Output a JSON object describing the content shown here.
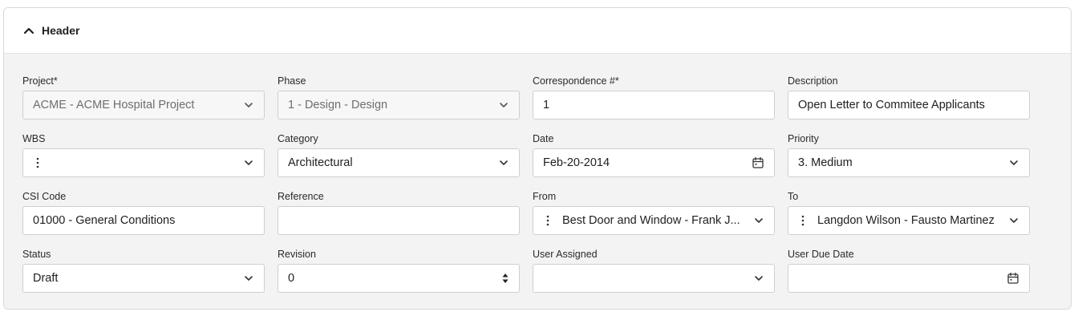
{
  "panel": {
    "title": "Header"
  },
  "fields": {
    "project": {
      "label": "Project*",
      "value": "ACME - ACME Hospital Project"
    },
    "phase": {
      "label": "Phase",
      "value": "1 - Design - Design"
    },
    "correspondence": {
      "label": "Correspondence #*",
      "value": "1"
    },
    "description": {
      "label": "Description",
      "value": "Open Letter to Commitee Applicants"
    },
    "wbs": {
      "label": "WBS",
      "value": ""
    },
    "category": {
      "label": "Category",
      "value": "Architectural"
    },
    "date": {
      "label": "Date",
      "value": "Feb-20-2014"
    },
    "priority": {
      "label": "Priority",
      "value": "3. Medium"
    },
    "csi_code": {
      "label": "CSI Code",
      "value": "01000 - General Conditions"
    },
    "reference": {
      "label": "Reference",
      "value": ""
    },
    "from": {
      "label": "From",
      "value": "Best Door and Window - Frank J..."
    },
    "to": {
      "label": "To",
      "value": "Langdon Wilson - Fausto Martinez"
    },
    "status": {
      "label": "Status",
      "value": "Draft"
    },
    "revision": {
      "label": "Revision",
      "value": "0"
    },
    "user_assigned": {
      "label": "User Assigned",
      "value": ""
    },
    "user_due_date": {
      "label": "User Due Date",
      "value": ""
    }
  },
  "icons": {
    "collapse": "chevron-up-icon",
    "dropdown": "chevron-down-icon",
    "calendar": "calendar-icon",
    "more": "kebab-icon",
    "spinner": "spinner-arrows-icon"
  },
  "colors": {
    "panel_bg": "#f3f3f3",
    "header_bg": "#ffffff",
    "border": "#cfcfcf",
    "disabled_text": "#6e6e6e"
  }
}
